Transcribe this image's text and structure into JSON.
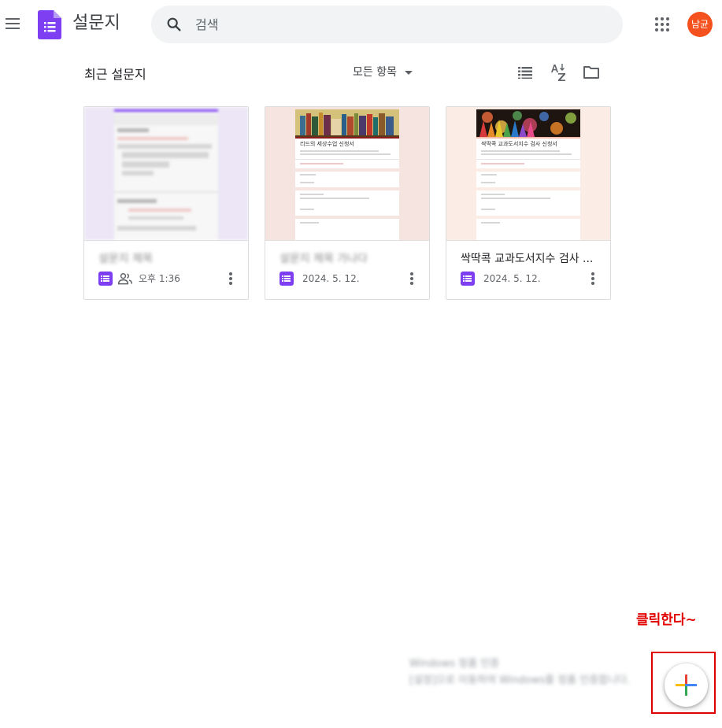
{
  "header": {
    "app_title": "설문지",
    "search_placeholder": "검색",
    "avatar_initials": "남균",
    "avatar_color": "#f4511e",
    "icons": [
      "menu-icon",
      "forms-logo-icon",
      "search-icon",
      "apps-grid-icon"
    ]
  },
  "toolbar": {
    "section_title": "최근 설문지",
    "owner_filter_label": "모든 항목",
    "icons": [
      "list-view-icon",
      "sort-az-icon",
      "folder-icon"
    ]
  },
  "cards": [
    {
      "title": "설문지 제목",
      "date": "오후 1:36",
      "shared": true,
      "title_blurred": true
    },
    {
      "title": "설문지 제목 가나다",
      "date": "2024. 5. 12.",
      "shared": false,
      "title_blurred": true
    },
    {
      "title": "싹딱콕 교과도서지수 검사 ...",
      "date": "2024. 5. 12.",
      "shared": false,
      "title_blurred": false
    }
  ],
  "thumbnails": {
    "card2_heading": "리드의 세상수업 신청서",
    "card3_heading": "싹딱콕 교과도서지수 검사 신청서"
  },
  "bottom": {
    "annotation_text": "클릭한다~",
    "blurred_notice_line1": "Windows 정품 인증",
    "blurred_notice_line2": "[설정]으로 이동하여 Windows를 정품 인증합니다.",
    "fab_icon": "add-plus-icon"
  },
  "colors": {
    "forms_purple": "#7e3ff2",
    "annotation_red": "#e00000",
    "plus_red": "#ea4335",
    "plus_blue": "#4285f4",
    "plus_yellow": "#fbbc04",
    "plus_green": "#34a853"
  }
}
